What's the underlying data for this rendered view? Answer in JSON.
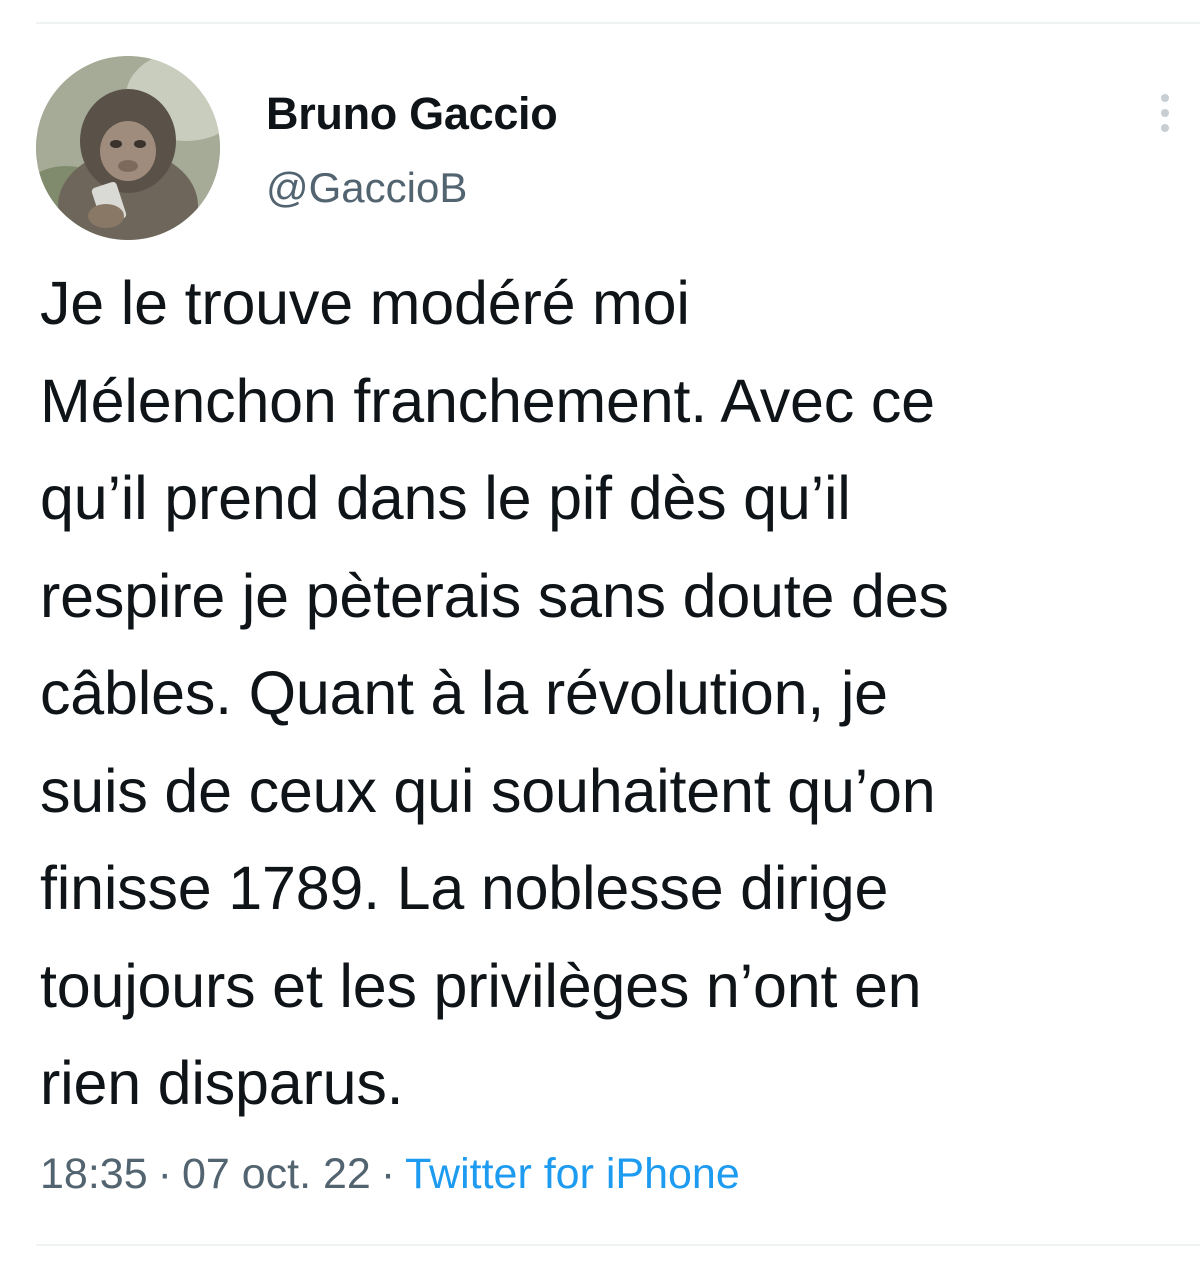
{
  "tweet": {
    "author": {
      "name": "Bruno Gaccio",
      "handle": "@GaccioB",
      "avatar_icon": "monkey-with-phone-avatar"
    },
    "more_icon": "vertical-ellipsis-icon",
    "text_lines": [
      "Je le trouve modéré moi",
      "Mélenchon franchement. Avec ce",
      "qu’il prend dans le pif dès qu’il",
      "respire je pèterais sans doute des",
      "câbles. Quant à la révolution, je",
      "suis de ceux qui souhaitent qu’on",
      "finisse 1789. La noblesse dirige",
      "toujours et les privilèges n’ont en",
      "rien disparus."
    ],
    "meta": {
      "time": "18:35",
      "separator": "·",
      "date": "07 oct. 22",
      "source": "Twitter for iPhone"
    }
  },
  "colors": {
    "text": "#0f1419",
    "secondary": "#536471",
    "link": "#1d9bf0",
    "divider": "#eff3f4"
  }
}
